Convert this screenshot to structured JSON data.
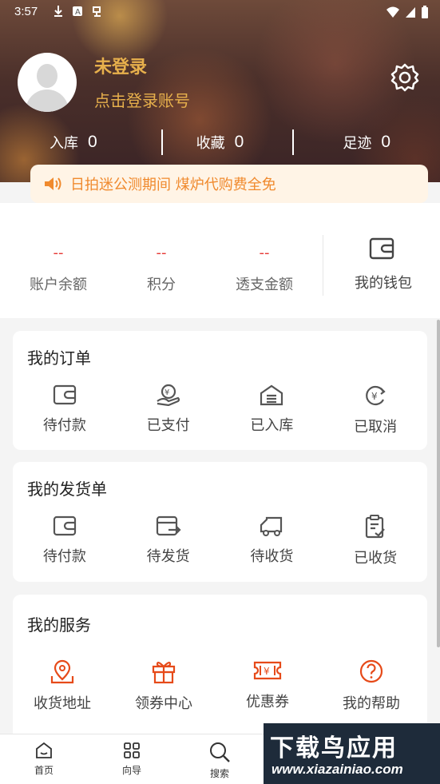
{
  "status_bar": {
    "time": "3:57",
    "icons": [
      "download-icon",
      "a-icon",
      "notification-icon"
    ],
    "right_icons": [
      "wifi-icon",
      "signal-icon",
      "battery-icon"
    ]
  },
  "profile": {
    "name": "未登录",
    "login_hint": "点击登录账号"
  },
  "stats": [
    {
      "label": "入库",
      "value": "0"
    },
    {
      "label": "收藏",
      "value": "0"
    },
    {
      "label": "足迹",
      "value": "0"
    }
  ],
  "notice": {
    "text": "日拍迷公测期间 煤炉代购费全免"
  },
  "wallet": {
    "items": [
      {
        "value": "--",
        "label": "账户余额"
      },
      {
        "value": "--",
        "label": "积分"
      },
      {
        "value": "--",
        "label": "透支金额"
      }
    ],
    "my_wallet": "我的钱包"
  },
  "orders": {
    "title": "我的订单",
    "items": [
      {
        "label": "待付款",
        "icon": "wallet-icon"
      },
      {
        "label": "已支付",
        "icon": "payment-icon"
      },
      {
        "label": "已入库",
        "icon": "warehouse-icon"
      },
      {
        "label": "已取消",
        "icon": "refund-icon"
      }
    ]
  },
  "shipments": {
    "title": "我的发货单",
    "items": [
      {
        "label": "待付款",
        "icon": "wallet-icon"
      },
      {
        "label": "待发货",
        "icon": "send-icon"
      },
      {
        "label": "待收货",
        "icon": "truck-icon"
      },
      {
        "label": "已收货",
        "icon": "clipboard-check-icon"
      }
    ]
  },
  "services": {
    "title": "我的服务",
    "items": [
      {
        "label": "收货地址",
        "icon": "map-pin-icon"
      },
      {
        "label": "领券中心",
        "icon": "gift-icon"
      },
      {
        "label": "优惠券",
        "icon": "ticket-icon"
      },
      {
        "label": "我的帮助",
        "icon": "help-icon"
      }
    ]
  },
  "tabbar": [
    {
      "label": "首页",
      "icon": "home-icon"
    },
    {
      "label": "向导",
      "icon": "grid-icon"
    },
    {
      "label": "搜索",
      "icon": "search-icon"
    }
  ],
  "watermark": {
    "title": "下载鸟应用",
    "url": "www.xiazainiao.com"
  },
  "colors": {
    "accent": "#e7b04c",
    "notice": "#f08a2e",
    "service_icon": "#e64a19",
    "value_red": "#e53935"
  }
}
